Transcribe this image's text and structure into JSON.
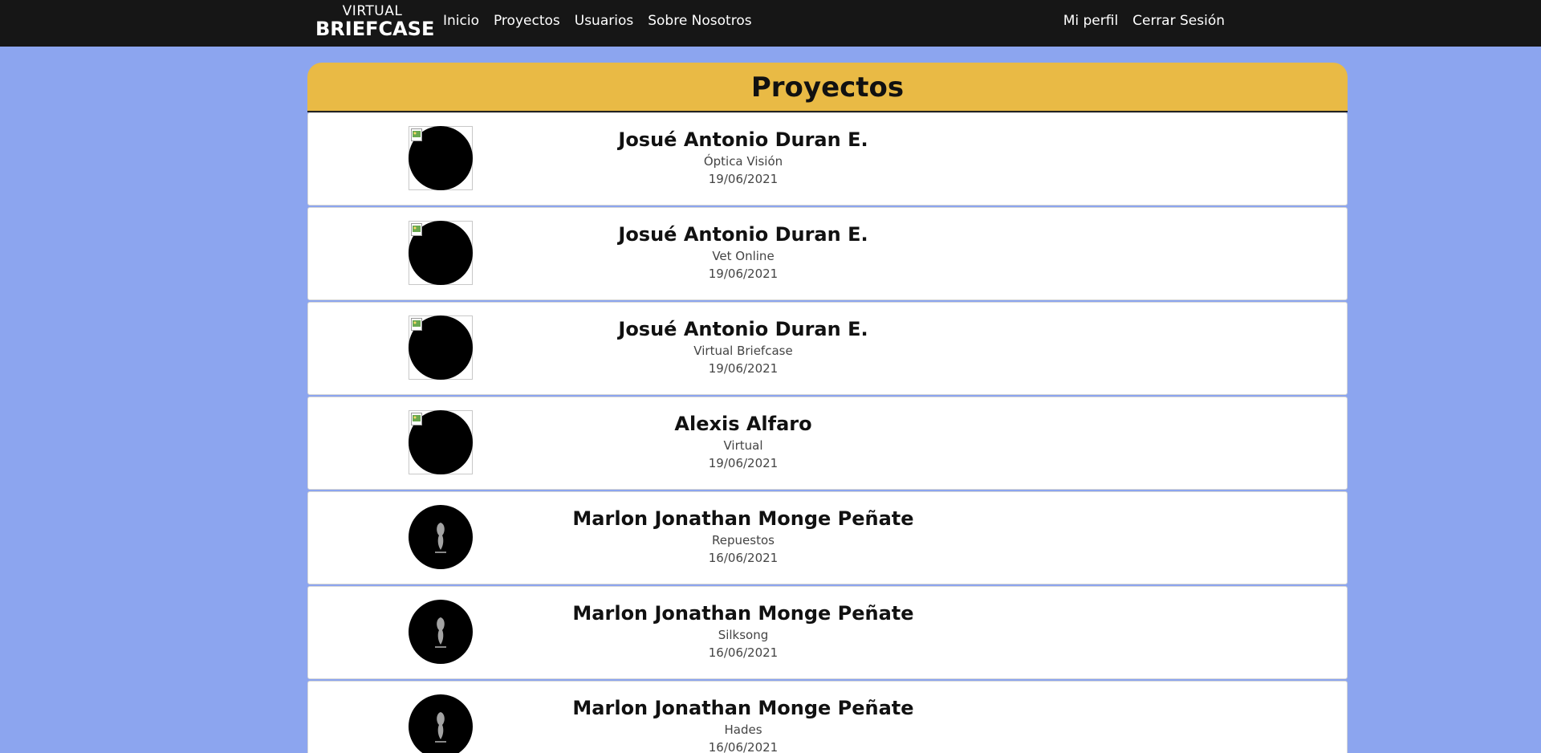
{
  "navbar": {
    "brand_top": "VIRTUAL",
    "brand_bottom": "BRIEFCASE",
    "links": [
      "Inicio",
      "Proyectos",
      "Usuarios",
      "Sobre Nosotros"
    ],
    "right_links": [
      "Mi perfil",
      "Cerrar Sesión"
    ]
  },
  "panel": {
    "title": "Proyectos"
  },
  "projects": [
    {
      "author": "Josué Antonio Duran E.",
      "project": "Óptica Visión",
      "date": "19/06/2021",
      "avatar": "broken-image-icon"
    },
    {
      "author": "Josué Antonio Duran E.",
      "project": "Vet Online",
      "date": "19/06/2021",
      "avatar": "broken-image-icon"
    },
    {
      "author": "Josué Antonio Duran E.",
      "project": "Virtual Briefcase",
      "date": "19/06/2021",
      "avatar": "broken-image-icon"
    },
    {
      "author": "Alexis Alfaro",
      "project": "Virtual",
      "date": "19/06/2021",
      "avatar": "broken-image-icon"
    },
    {
      "author": "Marlon Jonathan Monge Peñate",
      "project": "Repuestos",
      "date": "16/06/2021",
      "avatar": "profile-photo"
    },
    {
      "author": "Marlon Jonathan Monge Peñate",
      "project": "Silksong",
      "date": "16/06/2021",
      "avatar": "profile-photo"
    },
    {
      "author": "Marlon Jonathan Monge Peñate",
      "project": "Hades",
      "date": "16/06/2021",
      "avatar": "profile-photo"
    }
  ],
  "colors": {
    "background": "#8ca5ef",
    "navbar": "#161616",
    "header": "#e9ba45"
  }
}
